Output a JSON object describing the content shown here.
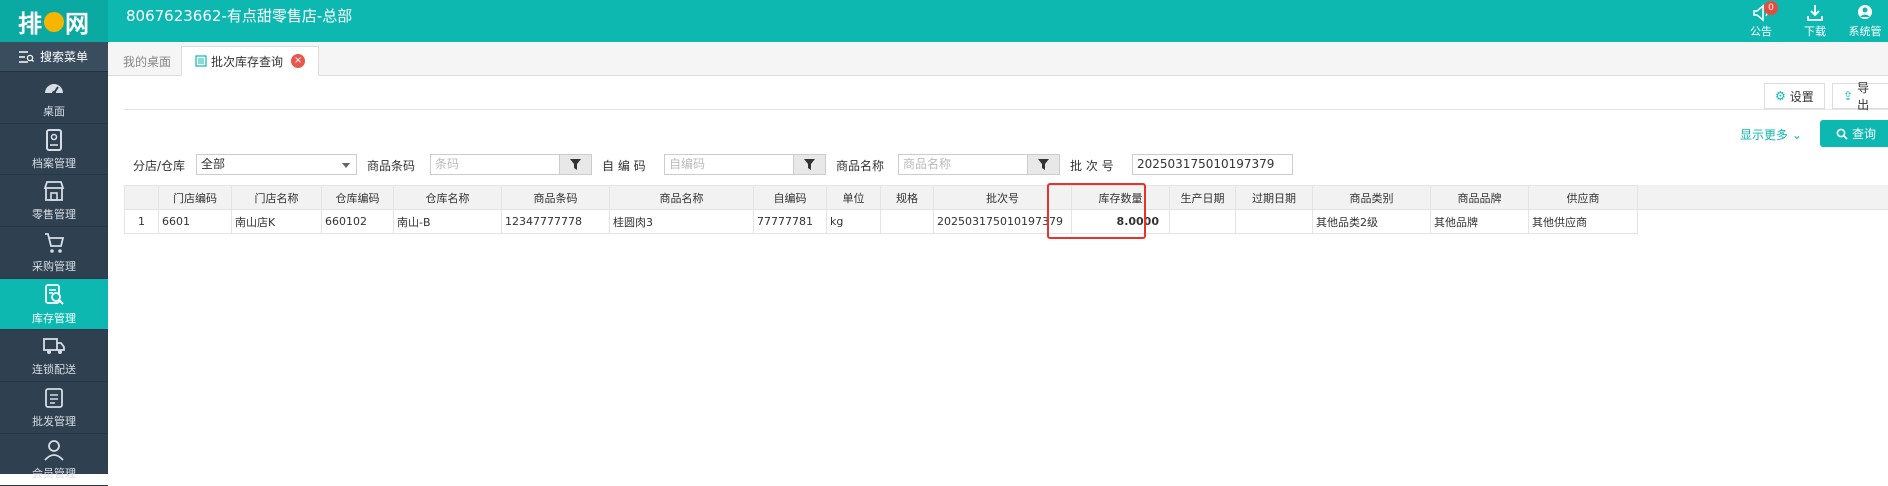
{
  "header": {
    "logo_text_left": "排",
    "logo_text_right": "网",
    "shop_title": "8067623662-有点甜零售店-总部",
    "icons": [
      {
        "name": "bell-icon",
        "label": "公告",
        "badge": "0"
      },
      {
        "name": "download-icon",
        "label": "下载"
      },
      {
        "name": "user-icon",
        "label": "系统管"
      }
    ]
  },
  "sidebar": {
    "search_label": "搜索菜单",
    "items": [
      {
        "label": "桌面",
        "icon": "dashboard-icon"
      },
      {
        "label": "档案管理",
        "icon": "archive-icon"
      },
      {
        "label": "零售管理",
        "icon": "store-icon"
      },
      {
        "label": "采购管理",
        "icon": "cart-icon"
      },
      {
        "label": "库存管理",
        "icon": "inventory-icon",
        "active": true
      },
      {
        "label": "连锁配送",
        "icon": "truck-icon"
      },
      {
        "label": "批发管理",
        "icon": "wholesale-icon"
      },
      {
        "label": "会员管理",
        "icon": "member-icon"
      }
    ]
  },
  "tabs": {
    "home": "我的桌面",
    "active": "批次库存查询",
    "close_glyph": "×"
  },
  "toolbar": {
    "settings_label": "设置",
    "export_label": "导出",
    "show_more_label": "显示更多",
    "query_label": "查询"
  },
  "filters": {
    "store_label": "分店/仓库",
    "store_value": "全部",
    "barcode_label": "商品条码",
    "barcode_placeholder": "条码",
    "selfcode_label": "自 编 码",
    "selfcode_placeholder": "自编码",
    "name_label": "商品名称",
    "name_placeholder": "商品名称",
    "batch_label": "批 次 号",
    "batch_value": "202503175010197379"
  },
  "table": {
    "columns": [
      "",
      "门店编码",
      "门店名称",
      "仓库编码",
      "仓库名称",
      "商品条码",
      "商品名称",
      "自编码",
      "单位",
      "规格",
      "批次号",
      "库存数量",
      "生产日期",
      "过期日期",
      "商品类别",
      "商品品牌",
      "供应商"
    ],
    "rows": [
      [
        "1",
        "6601",
        "南山店K",
        "660102",
        "南山-B",
        "12347777778",
        "桂圆肉3",
        "77777781",
        "kg",
        "",
        "202503175010197379",
        "8.0000",
        "",
        "",
        "其他品类2级",
        "其他品牌",
        "其他供应商"
      ]
    ]
  },
  "colors": {
    "brand": "#0cb8b0",
    "sidebar_bg": "#2f4050",
    "highlight": "#e8332a"
  }
}
